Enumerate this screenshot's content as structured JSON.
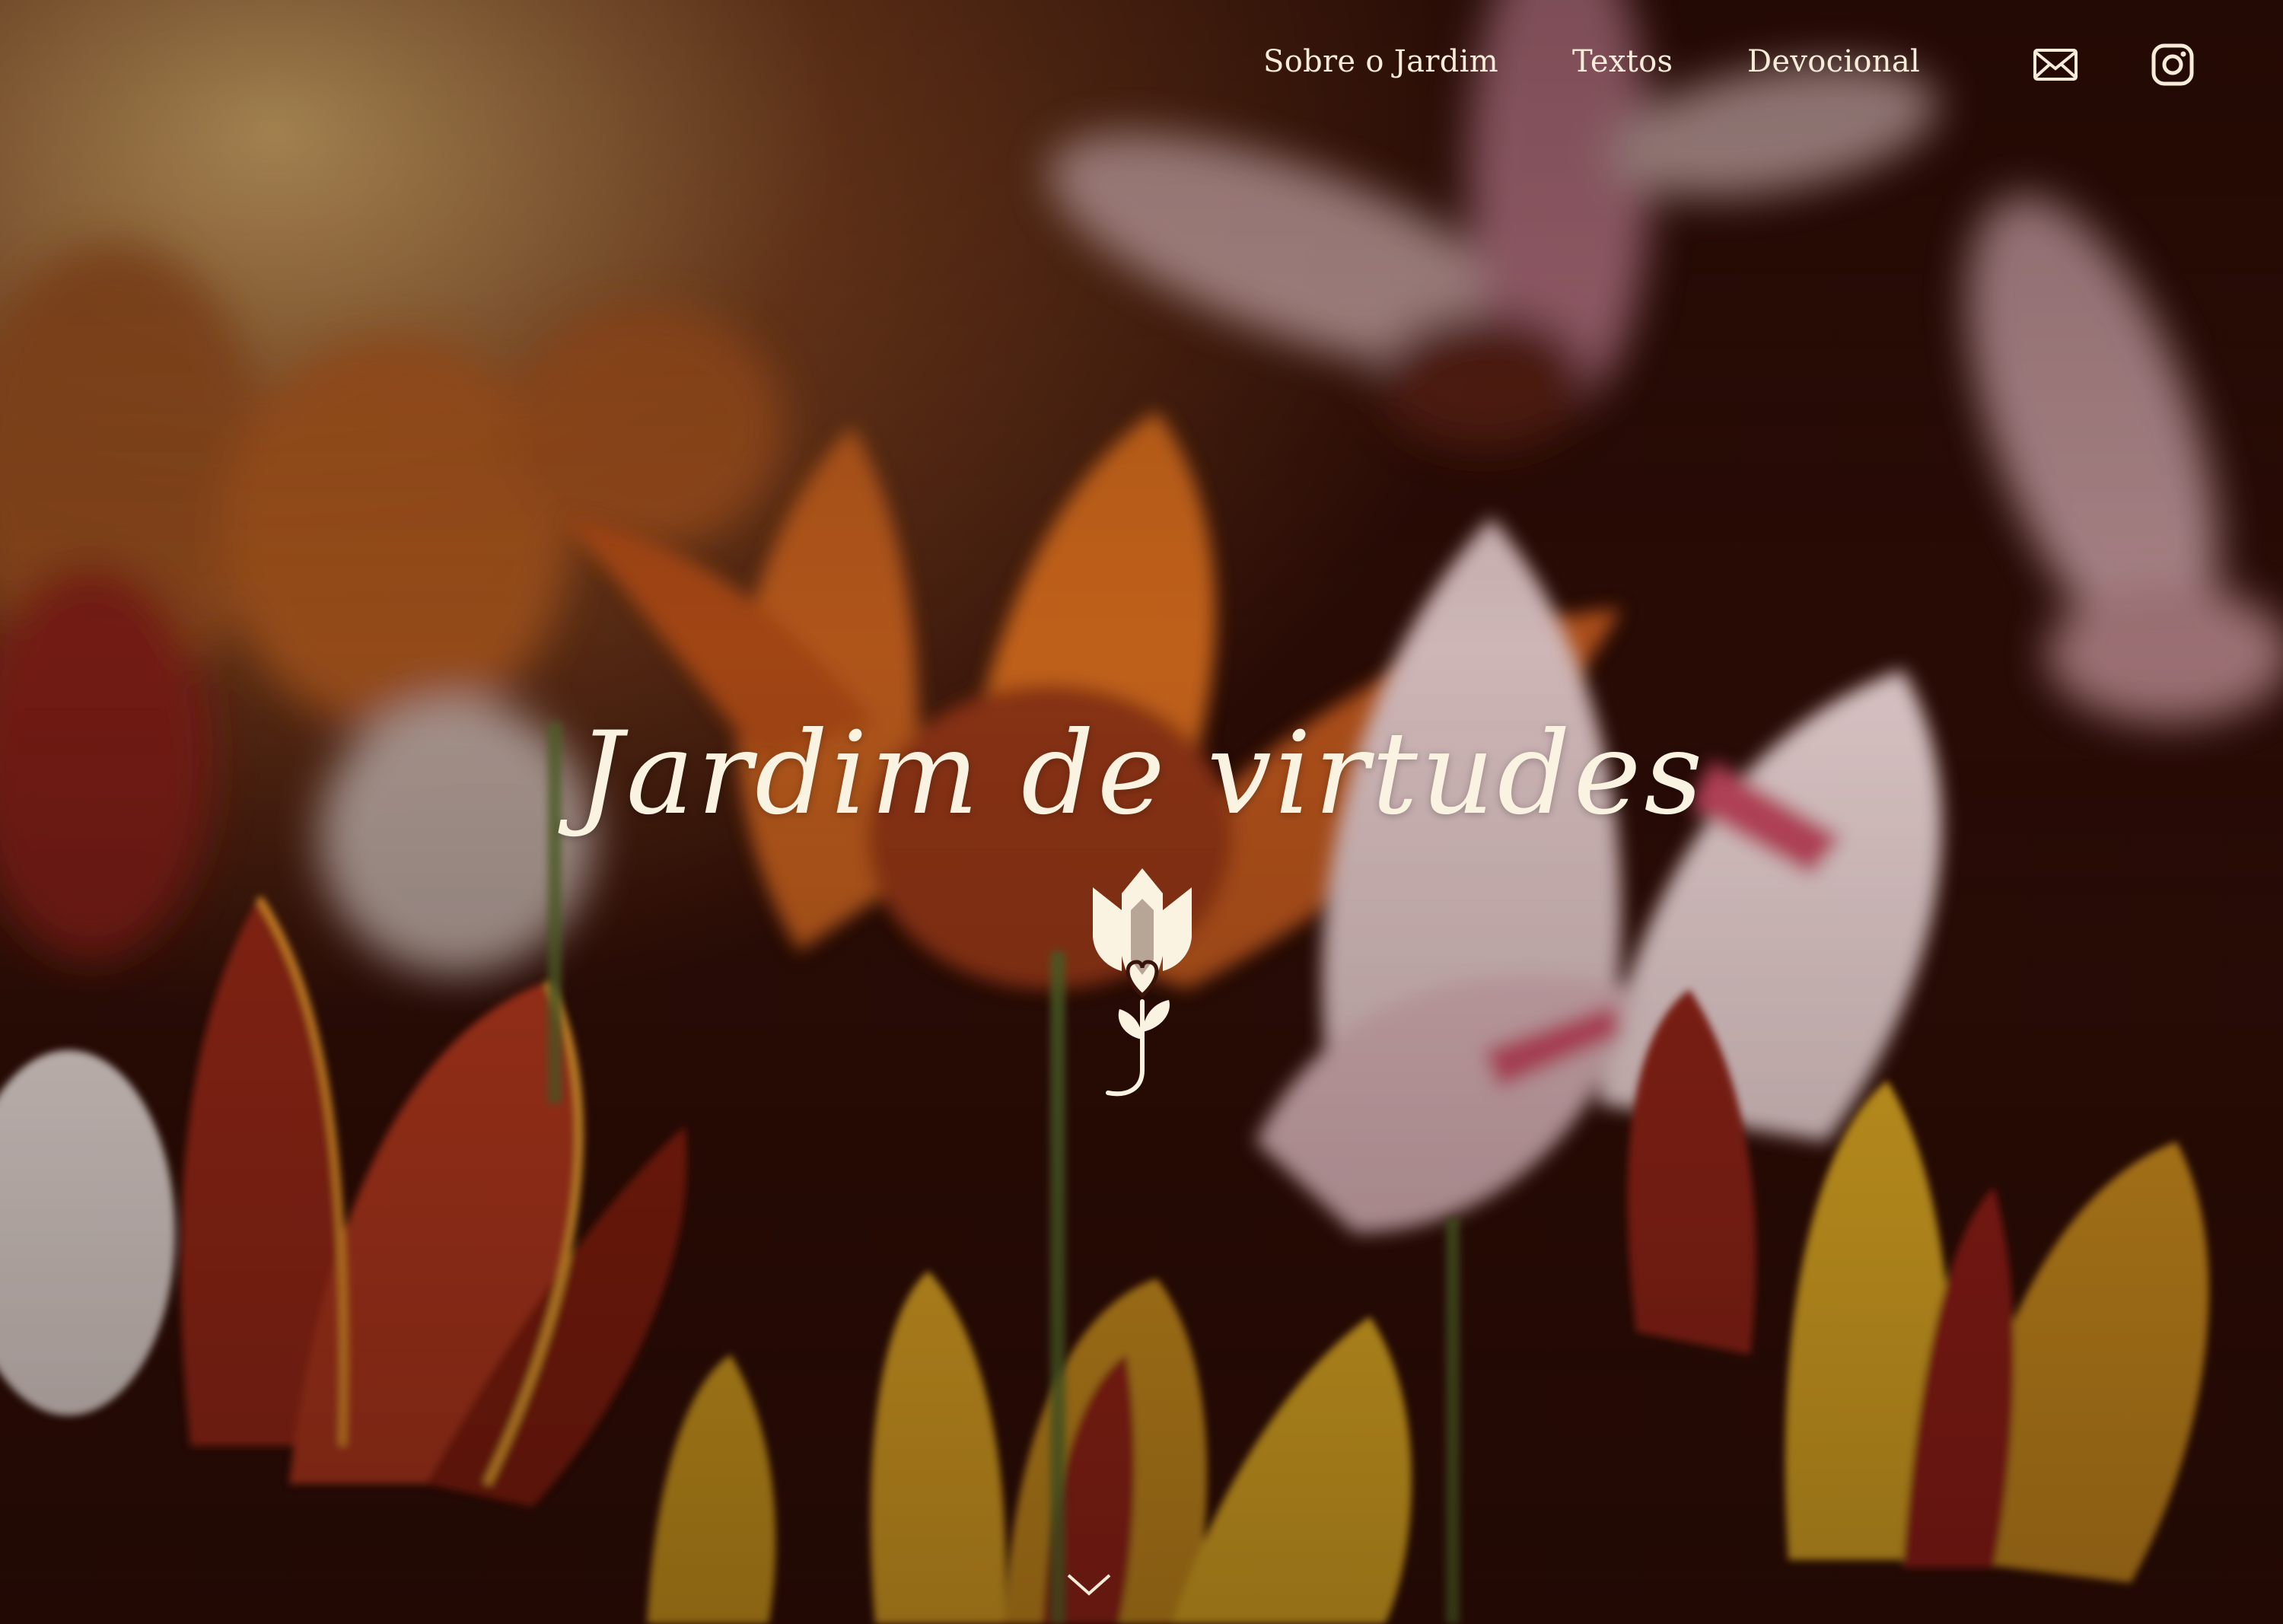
{
  "nav": {
    "links": [
      {
        "label": "Sobre o Jardim"
      },
      {
        "label": "Textos"
      },
      {
        "label": "Devocional"
      }
    ],
    "icons": [
      "envelope-icon",
      "instagram-icon"
    ]
  },
  "hero": {
    "title": "Jardim de virtudes",
    "logo_icon": "tulip-heart-icon",
    "scroll_icon": "chevron-down-icon"
  },
  "colors": {
    "text": "#fbf3e1",
    "overlay": "#2a0e08"
  }
}
